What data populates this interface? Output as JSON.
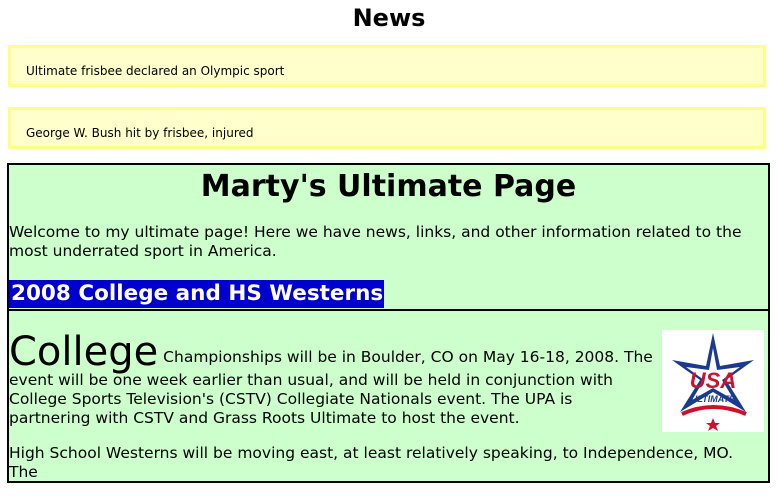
{
  "news": {
    "title": "News",
    "items": [
      "Ultimate frisbee declared an Olympic sport",
      "George W. Bush hit by frisbee, injured"
    ]
  },
  "main": {
    "title": "Marty's Ultimate Page",
    "intro": "Welcome to my ultimate page! Here we have news, links, and other information related to the most underrated sport in America.",
    "section_heading": "2008 College and HS Westerns",
    "college_word": "College",
    "college_text": " Championships will be in Boulder, CO on May 16-18, 2008. The event will be one week earlier than usual, and will be held in conjunction with College Sports Television's (CSTV) Collegiate Nationals event. The UPA is partnering with CSTV and Grass Roots Ultimate to host the event.",
    "hs_text": "High School Westerns will be moving east, at least relatively speaking, to Independence, MO. The",
    "logo": {
      "name": "usa-ultimate-logo",
      "colors": {
        "blue": "#1a3a8f",
        "red": "#d0102a",
        "white": "#ffffff"
      }
    }
  },
  "colors": {
    "news_bg": "#ffffcc",
    "news_border": "#ffff88",
    "main_bg": "#ccffcc",
    "heading_bg": "#0000cc"
  }
}
